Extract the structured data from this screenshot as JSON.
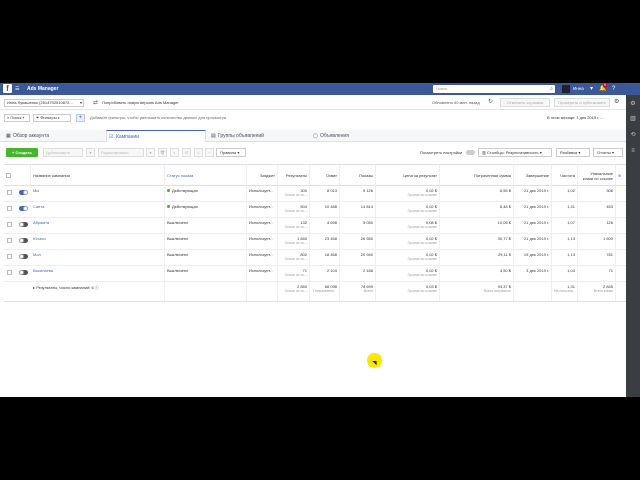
{
  "topbar": {
    "app_name": "Ads Manager",
    "menu_icon": "hamburger-icon",
    "search_placeholder": "Поиск",
    "user_name": "Инна",
    "notif_count": "9"
  },
  "account": {
    "selected": "Инна Лукашенко (2514752510872...",
    "try_new": "Попробовать новую версию Ads Manager",
    "updated": "Обновлено 40 мин. назад",
    "btn_discard": "Отменить черновик",
    "btn_review": "Проверить и публиковать"
  },
  "filters": {
    "search": "Поиск",
    "filters": "Фильтры",
    "hint": "Добавьте фильтры, чтобы уменьшить количество данных для просмотра.",
    "date_range": "В этом месяце: 1 дек 2019 г. –"
  },
  "tabs": [
    {
      "label": "Обзор аккаунта",
      "icon": "account-overview-icon"
    },
    {
      "label": "Кампании",
      "icon": "campaign-icon"
    },
    {
      "label": "Группы объявлений",
      "icon": "adsets-icon"
    },
    {
      "label": "Объявления",
      "icon": "ads-icon"
    }
  ],
  "toolbar": {
    "create": "+ Создать",
    "duplicate": "Дублировать",
    "edit": "Редактировать",
    "rules": "Правила",
    "view_settings": "Посмотреть настройки",
    "columns": "Столбцы: Результативность",
    "breakdown": "Разбивка",
    "reports": "Отчеты"
  },
  "table": {
    "headers": [
      "Название кампании",
      "Статус показа",
      "Бюджет",
      "Результаты",
      "Охват",
      "Показы",
      "Цена за результат",
      "Потраченная сумма",
      "Завершение",
      "Частота",
      "Уникальные клики по ссылке"
    ],
    "rows": [
      {
        "toggle": "on",
        "name": "Мы",
        "status": "Действующая",
        "status_color": "#42b72a",
        "budget": "Использует...",
        "results": "300",
        "results_sub": "Клики по сс...",
        "reach": "8 013",
        "impressions": "9 126",
        "cpr": "0,02 $",
        "cpr_sub": "За клик по ссылке",
        "spent": "6,55 $",
        "end": "21 дек 2019 г.",
        "freq": "1,02",
        "clicks": "306"
      },
      {
        "toggle": "on",
        "name": "Сапта",
        "status": "Действующая",
        "status_color": "#42b72a",
        "budget": "Использует...",
        "results": "504",
        "results_sub": "Клики по сс...",
        "reach": "10 488",
        "impressions": "14 814",
        "cpr": "0,02 $",
        "cpr_sub": "За клик по ссылке",
        "spent": "8,48 $",
        "end": "21 дек 2019 г.",
        "freq": "1,41",
        "clicks": "453"
      },
      {
        "toggle": "off",
        "name": "Абрамта",
        "status": "Выключено",
        "status_color": "#999999",
        "budget": "Использует...",
        "results": "132",
        "results_sub": "Клики по сс...",
        "reach": "4 698",
        "impressions": "5 050",
        "cpr": "0,08 $",
        "cpr_sub": "За клик по ссылке",
        "spent": "10,05 $",
        "end": "21 дек 2019 г.",
        "freq": "1,07",
        "clicks": "126"
      },
      {
        "toggle": "off",
        "name": "Ючачи",
        "status": "Выключено",
        "status_color": "#999999",
        "budget": "Использует...",
        "results": "1 840",
        "results_sub": "Клики по сс...",
        "reach": "23 458",
        "impressions": "26 550",
        "cpr": "0,02 $",
        "cpr_sub": "За клик по ссылке",
        "spent": "30,77 $",
        "end": "21 дек 2019 г.",
        "freq": "1,13",
        "clicks": "1 600"
      },
      {
        "toggle": "off",
        "name": "Мол",
        "status": "Выключено",
        "status_color": "#999999",
        "budget": "Использует...",
        "results": "802",
        "results_sub": "Клики по сс...",
        "reach": "18 468",
        "impressions": "20 940",
        "cpr": "0,02 $",
        "cpr_sub": "За клик по ссылке",
        "spent": "29,11 $",
        "end": "19 дек 2019 г.",
        "freq": "1,13",
        "clicks": "781"
      },
      {
        "toggle": "off",
        "name": "Васильева",
        "status": "Выключено",
        "status_color": "#999999",
        "budget": "Использует...",
        "results": "71",
        "results_sub": "Клики по сс...",
        "reach": "2 104",
        "impressions": "2 188",
        "cpr": "0,02 $",
        "cpr_sub": "За клик по ссылке",
        "spent": "4,50 $",
        "end": "3 дек 2019 г.",
        "freq": "1,04",
        "clicks": "71"
      }
    ],
    "summary": {
      "label": "Результаты, число кампаний: 6",
      "results": "2 850",
      "results_sub": "Клики по сс...",
      "reach": "66 098",
      "reach_sub": "Пользовател...",
      "impressions": "78 699",
      "impressions_sub": "Всего",
      "cpr": "0,03 $",
      "cpr_sub": "За клик по ссылке",
      "spent": "93,37 $",
      "spent_sub": "Всего потрачено",
      "freq": "1,31",
      "freq_sub": "На пользов...",
      "clicks": "2 845",
      "clicks_sub": "Всего клики"
    }
  }
}
